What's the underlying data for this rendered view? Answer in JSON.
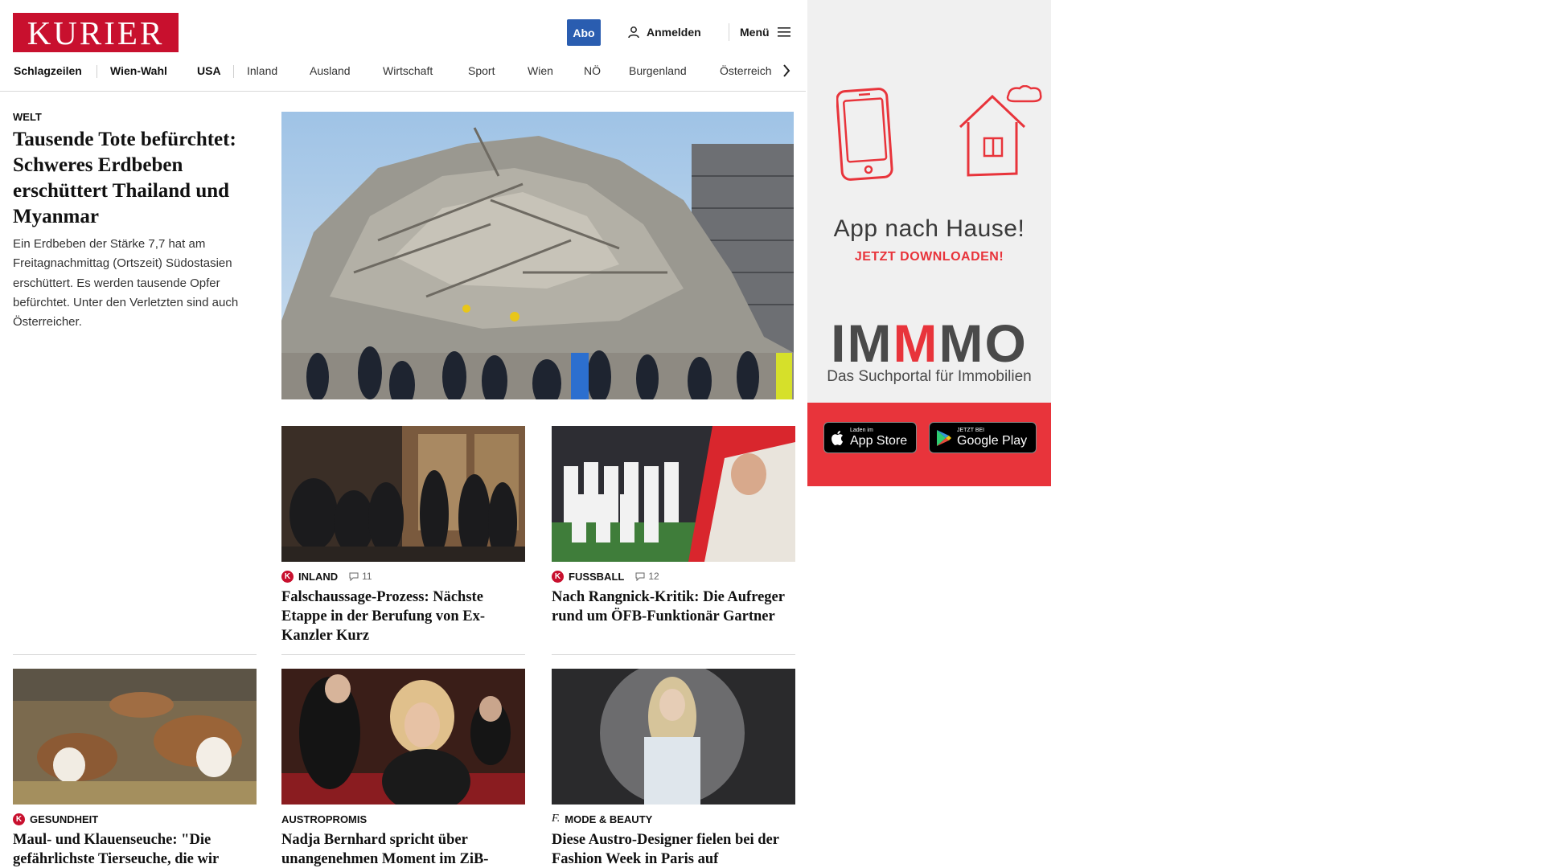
{
  "header": {
    "logo": "KURIER",
    "abo_label": "Abo",
    "login_label": "Anmelden",
    "menu_label": "Menü"
  },
  "nav": {
    "items": [
      "Schlagzeilen",
      "Wien-Wahl",
      "USA",
      "Inland",
      "Ausland",
      "Wirtschaft",
      "Sport",
      "Wien",
      "NÖ",
      "Burgenland",
      "Österreich"
    ]
  },
  "lead": {
    "kicker": "WELT",
    "title": "Tausende Tote befürchtet: Schweres Erdbeben erschüttert Thailand und Myanmar",
    "teaser": "Ein Erdbeben der Stärke 7,7 hat am Freitagnachmittag (Ortszeit) Südostasien erschüttert. Es werden tausende Opfer befürchtet. Unter den Verletzten sind auch Österreicher."
  },
  "cards": [
    {
      "category": "INLAND",
      "comments": "11",
      "title": "Falschaussage-Prozess: Nächste Etappe in der Berufung von Ex-Kanzler Kurz"
    },
    {
      "category": "FUSSBALL",
      "comments": "12",
      "title": "Nach Rangnick-Kritik: Die Aufreger rund um ÖFB-Funktionär Gartner"
    },
    {
      "category": "GESUNDHEIT",
      "title": "Maul- und Klauenseuche: \"Die gefährlichste Tierseuche, die wir kennen\""
    },
    {
      "category": "AUSTROPROMIS",
      "title": "Nadja Bernhard spricht über unangenehmen Moment im ZiB-Studio"
    },
    {
      "category": "MODE & BEAUTY",
      "title": "Diese Austro-Designer fielen bei der Fashion Week in Paris auf"
    }
  ],
  "ad": {
    "headline": "App nach Hause!",
    "subline": "JETZT DOWNLOADEN!",
    "brand_prefix": "IM",
    "brand_mid": "M",
    "brand_suffix": "MO",
    "tagline": "Das Suchportal für Immobilien",
    "appstore_small": "Laden im",
    "appstore_big": "App Store",
    "googleplay_small": "JETZT BEI",
    "googleplay_big": "Google Play"
  },
  "colors": {
    "brand_red": "#c8102e",
    "abo_blue": "#2a5db0",
    "ad_red": "#e8343b"
  },
  "icons": [
    "user-icon",
    "hamburger-icon",
    "chevron-right-icon",
    "comment-icon",
    "kurier-k-badge-icon",
    "apple-icon",
    "google-play-icon",
    "smartphone-icon",
    "house-icon"
  ]
}
